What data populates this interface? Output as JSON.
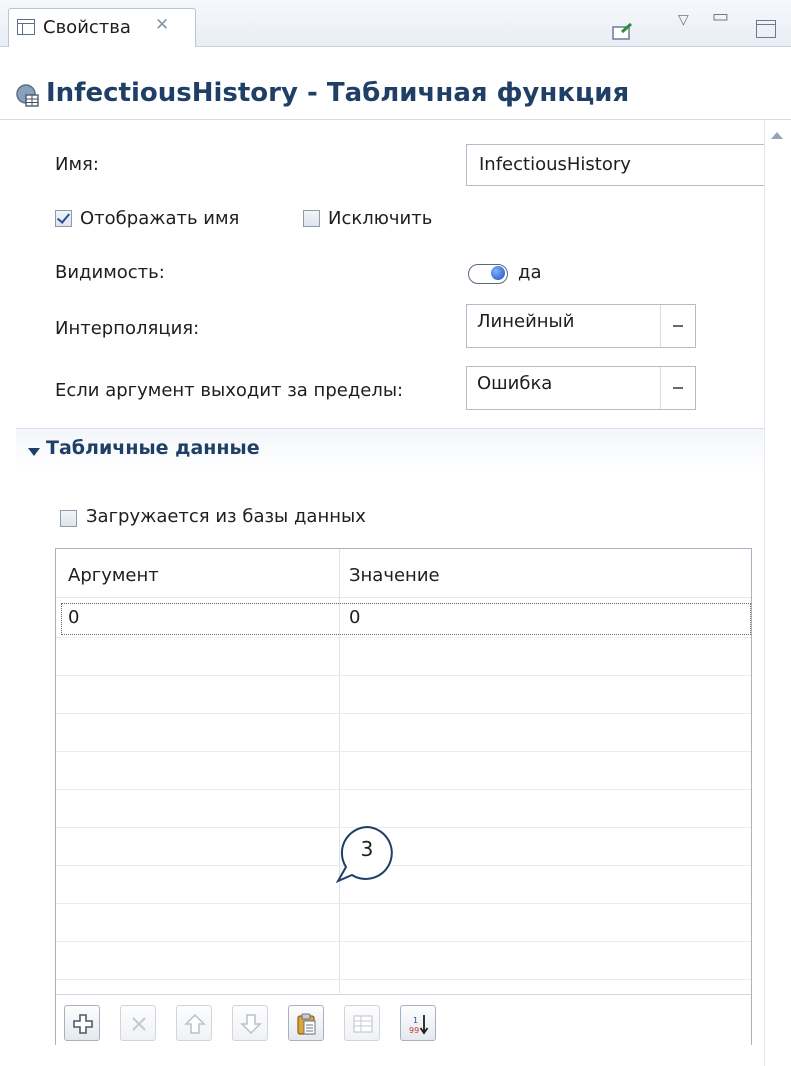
{
  "tab": {
    "label": "Свойства",
    "close": "✕"
  },
  "window_controls": {
    "view_menu": "▽",
    "minimize": "▭"
  },
  "header": {
    "title": "InfectiousHistory - Табличная функция"
  },
  "form": {
    "name_label": "Имя:",
    "name_value": "InfectiousHistory",
    "show_name_label": "Отображать имя",
    "show_name_checked": true,
    "exclude_label": "Исключить",
    "exclude_checked": false,
    "visibility_label": "Видимость:",
    "visibility_value": "да",
    "interpolation_label": "Интерполяция:",
    "interpolation_value": "Линейный",
    "out_of_range_label": "Если аргумент выходит за пределы:",
    "out_of_range_value": "Ошибка"
  },
  "section": {
    "title": "Табличные данные",
    "load_from_db_label": "Загружается из базы данных",
    "load_from_db_checked": false
  },
  "table": {
    "columns": [
      "Аргумент",
      "Значение"
    ],
    "rows": [
      [
        "0",
        "0"
      ]
    ]
  },
  "toolbar": {
    "buttons": [
      "add-row",
      "delete-row",
      "move-up",
      "move-down",
      "paste",
      "copy",
      "sort"
    ]
  },
  "callout": {
    "number": "3"
  }
}
